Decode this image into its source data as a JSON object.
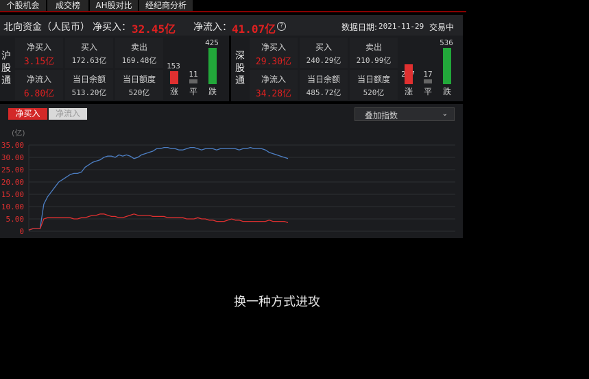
{
  "tabs": [
    "个股机会",
    "成交榜",
    "AH股对比",
    "经纪商分析"
  ],
  "header": {
    "title": "北向资金（人民币）",
    "net_buy_label": "净买入：",
    "net_buy_value": "32.45亿",
    "net_inflow_label": "净流入：",
    "net_inflow_value": "41.07亿",
    "help_icon": "?",
    "date_label": "数据日期:",
    "date_value": "2021-11-29",
    "status": "交易中"
  },
  "sh": {
    "name": [
      "沪",
      "股",
      "通"
    ],
    "net_buy_label": "净买入",
    "net_buy": "3.15亿",
    "buy_label": "买入",
    "buy": "172.63亿",
    "sell_label": "卖出",
    "sell": "169.48亿",
    "net_inflow_label": "净流入",
    "net_inflow": "6.80亿",
    "balance_label": "当日余额",
    "balance": "513.20亿",
    "quota_label": "当日额度",
    "quota": "520亿",
    "up": "153",
    "flat": "11",
    "down": "425",
    "up_label": "涨",
    "flat_label": "平",
    "down_label": "跌"
  },
  "sz": {
    "name": [
      "深",
      "股",
      "通"
    ],
    "net_buy_label": "净买入",
    "net_buy": "29.30亿",
    "buy_label": "买入",
    "buy": "240.29亿",
    "sell_label": "卖出",
    "sell": "210.99亿",
    "net_inflow_label": "净流入",
    "net_inflow": "34.28亿",
    "balance_label": "当日余额",
    "balance": "485.72亿",
    "quota_label": "当日额度",
    "quota": "520亿",
    "up": "297",
    "flat": "17",
    "down": "536",
    "up_label": "涨",
    "flat_label": "平",
    "down_label": "跌"
  },
  "chart_controls": {
    "tab_active": "净买入",
    "tab_inactive": "净流入",
    "overlay_select": "叠加指数",
    "unit": "(亿)"
  },
  "chart_data": {
    "type": "line",
    "ylim": [
      0,
      35
    ],
    "yticks": [
      "35.00",
      "30.00",
      "25.00",
      "20.00",
      "15.00",
      "10.00",
      "5.00",
      "0"
    ],
    "series": [
      {
        "color": "#4d7fc4",
        "values": [
          0.5,
          1,
          1,
          1,
          11,
          14,
          16,
          18,
          20,
          21,
          22,
          23,
          23.5,
          23.5,
          24,
          26,
          27,
          28,
          28.5,
          29,
          30,
          30.5,
          30.5,
          30,
          31,
          30.5,
          31,
          30.5,
          29.5,
          30,
          31,
          31.5,
          32,
          32.5,
          33.5,
          33.5,
          34,
          34,
          33.5,
          33.5,
          33,
          33,
          33.5,
          34,
          34,
          33.5,
          33,
          33.5,
          33.5,
          33.5,
          33,
          33.5,
          33.5,
          33.5,
          33.5,
          33.5,
          33,
          33.5,
          33.5,
          34,
          33.5,
          33.5,
          33.5,
          33,
          32,
          31.5,
          31,
          30.5,
          30,
          29.5
        ]
      },
      {
        "color": "#e03030",
        "values": [
          0.5,
          1,
          1,
          1,
          5,
          5.5,
          5.5,
          5.5,
          5.5,
          5.5,
          5.5,
          5.5,
          5,
          5,
          5.5,
          5.5,
          6,
          6.5,
          6.5,
          7,
          7,
          6.5,
          6,
          6,
          5.5,
          5.5,
          6,
          6.5,
          7,
          6.5,
          6.5,
          6.5,
          6.5,
          6,
          6,
          6,
          6,
          5.5,
          5.5,
          5.5,
          5.5,
          5.5,
          5,
          5,
          5,
          5.5,
          5,
          5,
          4.5,
          4.5,
          4,
          4,
          4,
          4.5,
          5,
          4.5,
          4.5,
          4,
          4,
          4,
          4,
          4,
          4,
          4,
          4.5,
          4,
          4,
          4,
          4,
          3.5
        ]
      }
    ]
  },
  "caption": "换一种方式进攻"
}
